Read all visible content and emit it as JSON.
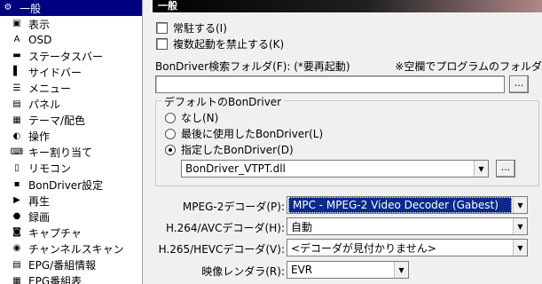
{
  "sidebar": {
    "items": [
      {
        "label": "一般",
        "icon": "gear-icon",
        "glyph": "⚙",
        "selected": true
      },
      {
        "label": "表示",
        "icon": "display-icon",
        "glyph": "▣"
      },
      {
        "label": "OSD",
        "icon": "osd-icon",
        "glyph": "A"
      },
      {
        "label": "ステータスバー",
        "icon": "statusbar-icon",
        "glyph": "▬"
      },
      {
        "label": "サイドバー",
        "icon": "sidebar-icon",
        "glyph": "▌"
      },
      {
        "label": "メニュー",
        "icon": "menu-icon",
        "glyph": "☰"
      },
      {
        "label": "パネル",
        "icon": "panel-icon",
        "glyph": "▤"
      },
      {
        "label": "テーマ/配色",
        "icon": "theme-icon",
        "glyph": "▦"
      },
      {
        "label": "操作",
        "icon": "mouse-icon",
        "glyph": "◐"
      },
      {
        "label": "キー割り当て",
        "icon": "keyboard-icon",
        "glyph": "⌨"
      },
      {
        "label": "リモコン",
        "icon": "remote-icon",
        "glyph": "▯"
      },
      {
        "label": "BonDriver設定",
        "icon": "bondriver-icon",
        "glyph": "▪"
      },
      {
        "label": "再生",
        "icon": "play-icon",
        "glyph": "▶"
      },
      {
        "label": "録画",
        "icon": "record-icon",
        "glyph": "●"
      },
      {
        "label": "キャプチャ",
        "icon": "camera-icon",
        "glyph": "◙"
      },
      {
        "label": "チャンネルスキャン",
        "icon": "scan-icon",
        "glyph": "◉"
      },
      {
        "label": "EPG/番組情報",
        "icon": "epg-info-icon",
        "glyph": "▤"
      },
      {
        "label": "EPG番組表",
        "icon": "epg-table-icon",
        "glyph": "▦"
      }
    ]
  },
  "header": {
    "title": "一般"
  },
  "general": {
    "resident_label": "常駐する(I)",
    "single_instance_label": "複数起動を禁止する(K)",
    "search_folder_label": "BonDriver検索フォルダ(F): (*要再起動)",
    "blank_note": "※空欄でプログラムのフォルダ",
    "search_folder_value": "",
    "browse_label": "...",
    "default_group_title": "デフォルトのBonDriver",
    "radio_none": "なし(N)",
    "radio_last": "最後に使用したBonDriver(L)",
    "radio_specified": "指定したBonDriver(D)",
    "bondriver_value": "BonDriver_VTPT.dll",
    "mpeg2_label": "MPEG-2デコーダ(P):",
    "mpeg2_value": "MPC - MPEG-2 Video Decoder (Gabest)",
    "h264_label": "H.264/AVCデコーダ(H):",
    "h264_value": "自動",
    "h265_label": "H.265/HEVCデコーダ(V):",
    "h265_value": "<デコーダが見付かりません>",
    "renderer_label": "映像レンダラ(R):",
    "renderer_value": "EVR"
  },
  "colors": {
    "selection": "#000080",
    "header_start": "#000000",
    "header_end": "#b08888",
    "combo_highlight": "#0a2a8a"
  }
}
